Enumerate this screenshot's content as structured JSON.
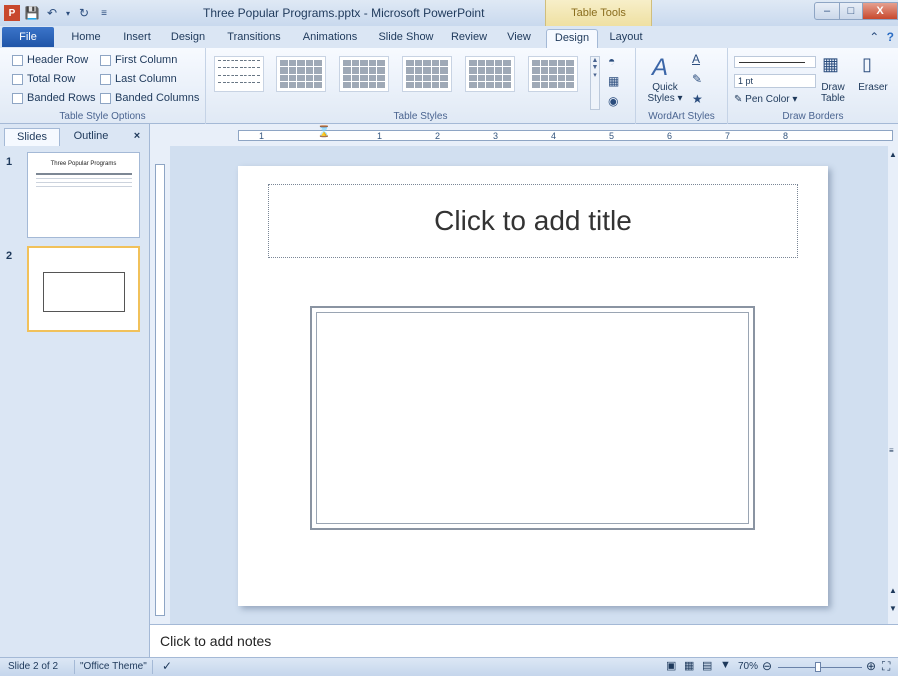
{
  "window": {
    "title": "Three Popular Programs.pptx - Microsoft PowerPoint",
    "context_tab": "Table Tools",
    "min_label": "–",
    "max_label": "□",
    "close_label": "X"
  },
  "tabs": {
    "file": "File",
    "home": "Home",
    "insert": "Insert",
    "design": "Design",
    "transitions": "Transitions",
    "animations": "Animations",
    "slideshow": "Slide Show",
    "review": "Review",
    "view": "View",
    "tt_design": "Design",
    "tt_layout": "Layout"
  },
  "ribbon": {
    "table_style_options": {
      "label": "Table Style Options",
      "header_row": "Header Row",
      "first_column": "First Column",
      "total_row": "Total Row",
      "last_column": "Last Column",
      "banded_rows": "Banded Rows",
      "banded_columns": "Banded Columns"
    },
    "table_styles": {
      "label": "Table Styles"
    },
    "wordart": {
      "label": "WordArt Styles",
      "quick_styles_line1": "Quick",
      "quick_styles_line2": "Styles ▾"
    },
    "draw_borders": {
      "label": "Draw Borders",
      "pen_weight": "1 pt",
      "pen_color": "Pen Color ▾",
      "draw_table_line1": "Draw",
      "draw_table_line2": "Table",
      "eraser": "Eraser"
    }
  },
  "leftpane": {
    "slides_tab": "Slides",
    "outline_tab": "Outline",
    "close_label": "×",
    "thumb1_number": "1",
    "thumb1_title": "Three Popular Programs",
    "thumb2_number": "2"
  },
  "hruler": {
    "ticks": [
      "1",
      "1",
      "2",
      "3",
      "4",
      "5",
      "6",
      "7",
      "8"
    ]
  },
  "slide": {
    "title_placeholder": "Click to add title"
  },
  "notes": {
    "placeholder": "Click to add notes"
  },
  "status": {
    "slide_info": "Slide 2 of 2",
    "theme": "\"Office Theme\"",
    "zoom": "70%"
  },
  "colors": {
    "accent": "#1f55a8",
    "context_tab": "#efe0a2"
  }
}
